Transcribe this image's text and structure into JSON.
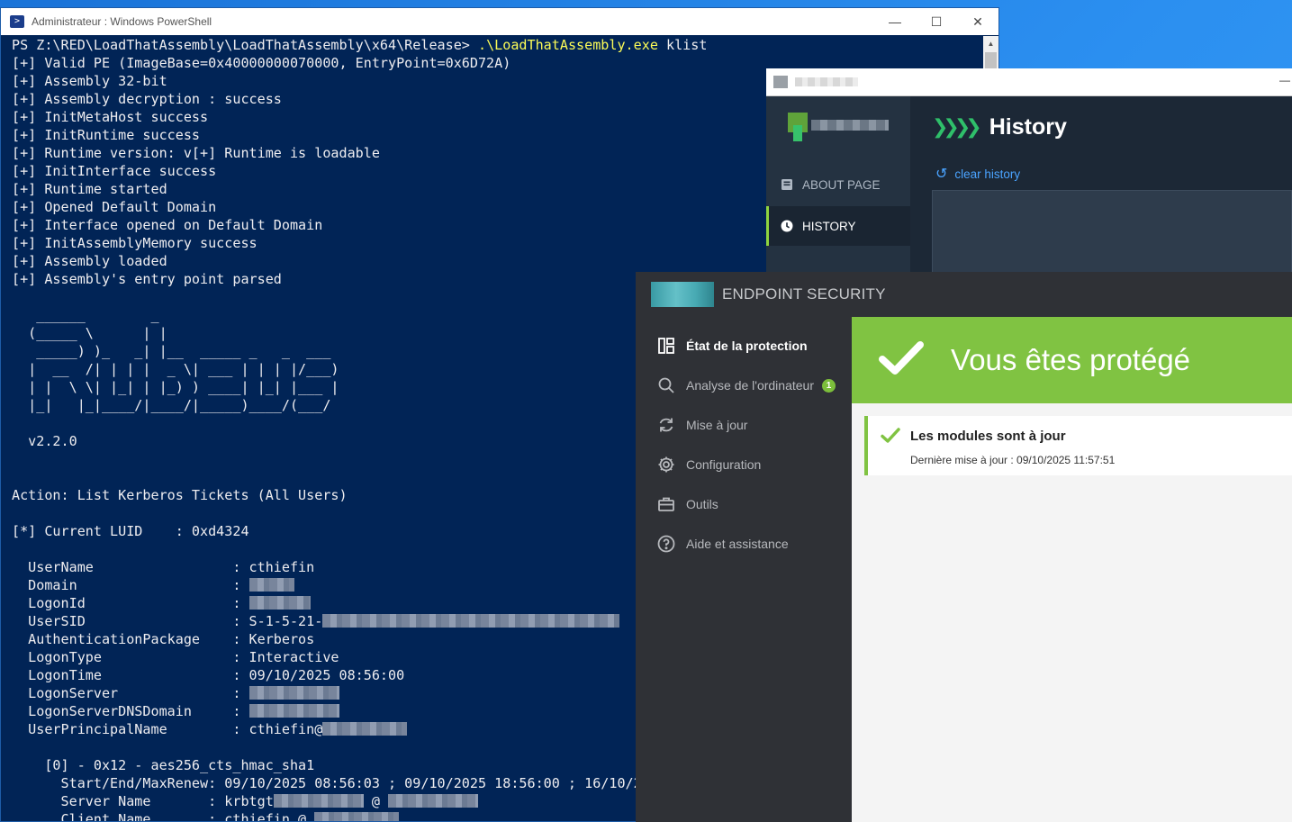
{
  "powershell": {
    "title": "Administrateur : Windows PowerShell",
    "lines": [
      {
        "t": "PS Z:\\RED\\LoadThatAssembly\\LoadThatAssembly\\x64\\Release> ",
        "cmd": ".\\LoadThatAssembly.exe",
        "rest": " klist"
      },
      {
        "t": "[+] Valid PE (ImageBase=0x40000000070000, EntryPoint=0x6D72A)"
      },
      {
        "t": "[+] Assembly 32-bit"
      },
      {
        "t": "[+] Assembly decryption : success"
      },
      {
        "t": "[+] InitMetaHost success"
      },
      {
        "t": "[+] InitRuntime success"
      },
      {
        "t": "[+] Runtime version: v[+] Runtime is loadable"
      },
      {
        "t": "[+] InitInterface success"
      },
      {
        "t": "[+] Runtime started"
      },
      {
        "t": "[+] Opened Default Domain"
      },
      {
        "t": "[+] Interface opened on Default Domain"
      },
      {
        "t": "[+] InitAssemblyMemory success"
      },
      {
        "t": "[+] Assembly loaded"
      },
      {
        "t": "[+] Assembly's entry point parsed"
      },
      {
        "t": ""
      },
      {
        "t": "   ______        _"
      },
      {
        "t": "  (_____ \\      | |"
      },
      {
        "t": "   _____) )_   _| |__  _____ _   _  ___"
      },
      {
        "t": "  |  __  /| | | |  _ \\| ___ | | | |/___)"
      },
      {
        "t": "  | |  \\ \\| |_| | |_) ) ____| |_| |___ |"
      },
      {
        "t": "  |_|   |_|____/|____/|_____)____/(___/"
      },
      {
        "t": ""
      },
      {
        "t": "  v2.2.0"
      },
      {
        "t": ""
      },
      {
        "t": ""
      },
      {
        "t": "Action: List Kerberos Tickets (All Users)"
      },
      {
        "t": ""
      },
      {
        "t": "[*] Current LUID    : 0xd4324"
      },
      {
        "t": ""
      },
      {
        "t": "  UserName                 : cthiefin"
      },
      {
        "t": "  Domain                   : ",
        "blur": [
          50
        ]
      },
      {
        "t": "  LogonId                  : ",
        "blur": [
          68
        ]
      },
      {
        "t": "  UserSID                  : S-1-5-21-",
        "blur": [
          330
        ]
      },
      {
        "t": "  AuthenticationPackage    : Kerberos"
      },
      {
        "t": "  LogonType                : Interactive"
      },
      {
        "t": "  LogonTime                : 09/10/2025 08:56:00"
      },
      {
        "t": "  LogonServer              : ",
        "blur": [
          100
        ]
      },
      {
        "t": "  LogonServerDNSDomain     : ",
        "blur": [
          100
        ]
      },
      {
        "t": "  UserPrincipalName        : cthiefin@",
        "blur": [
          94
        ]
      },
      {
        "t": ""
      },
      {
        "t": "    [0] - 0x12 - aes256_cts_hmac_sha1"
      },
      {
        "t": "      Start/End/MaxRenew: 09/10/2025 08:56:03 ; 09/10/2025 18:56:00 ; 16/10/2"
      },
      {
        "t": "      Server Name       : krbtgt",
        "blur": [
          100
        ],
        "rest2": " @ ",
        "blur2": [
          100
        ]
      },
      {
        "t": "      Client Name       : cthiefin @ ",
        "blur": [
          94
        ]
      }
    ]
  },
  "tool": {
    "nav": [
      {
        "label": "ABOUT PAGE",
        "icon": "book-icon"
      },
      {
        "label": "HISTORY",
        "icon": "clock-icon"
      }
    ],
    "heading": "History",
    "clear_label": "clear history"
  },
  "endpoint": {
    "brand": "ENDPOINT SECURITY",
    "nav": [
      {
        "label": "État de la protection",
        "icon": "dashboard-icon",
        "active": true
      },
      {
        "label": "Analyse de l'ordinateur",
        "icon": "search-icon",
        "badge": "1"
      },
      {
        "label": "Mise à jour",
        "icon": "refresh-icon"
      },
      {
        "label": "Configuration",
        "icon": "gear-icon"
      },
      {
        "label": "Outils",
        "icon": "briefcase-icon"
      },
      {
        "label": "Aide et assistance",
        "icon": "help-icon"
      }
    ],
    "banner": "Vous êtes protégé",
    "card_title": "Les modules sont à jour",
    "card_sub": "Dernière mise à jour : 09/10/2025 11:57:51",
    "accent": "#80c342"
  }
}
